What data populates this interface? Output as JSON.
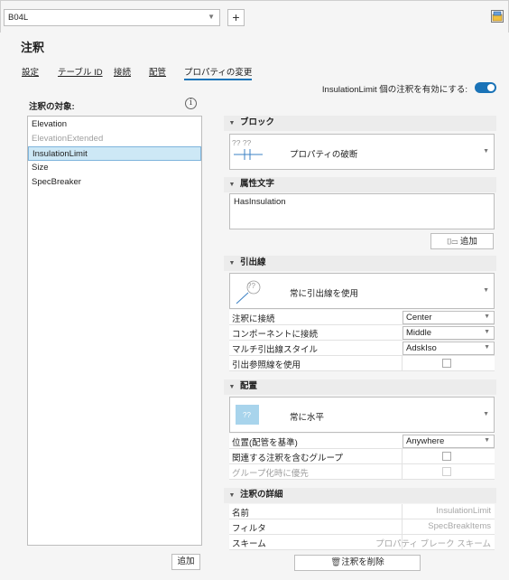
{
  "topbar": {
    "combo_value": "B04L",
    "add_symbol": "+"
  },
  "header": {
    "title": "注釈"
  },
  "tabs": [
    {
      "label": "設定"
    },
    {
      "label": "テーブル ID"
    },
    {
      "label": "接続"
    },
    {
      "label": "配管"
    },
    {
      "label": "プロパティの変更"
    }
  ],
  "toggle": {
    "label": "InsulationLimit 個の注釈を有効にする:",
    "on": true
  },
  "left": {
    "label": "注釈の対象:",
    "items": [
      "Elevation",
      "ElevationExtended",
      "InsulationLimit",
      "Size",
      "SpecBreaker"
    ],
    "add_label": "追加"
  },
  "block": {
    "title": "ブロック",
    "preview_text": "プロパティの破断",
    "thumb_text": "?? ??"
  },
  "attr": {
    "title": "属性文字",
    "value": "HasInsulation",
    "add_label": "追加"
  },
  "leader": {
    "title": "引出線",
    "preview_text": "常に引出線を使用",
    "thumb_text": "??",
    "rows": [
      {
        "label": "注釈に接続",
        "value": "Center"
      },
      {
        "label": "コンポーネントに接続",
        "value": "Middle"
      },
      {
        "label": "マルチ引出線スタイル",
        "value": "AdskIso"
      },
      {
        "label": "引出参照線を使用"
      }
    ]
  },
  "placement": {
    "title": "配置",
    "preview_text": "常に水平",
    "thumb_text": "??",
    "rows": [
      {
        "label": "位置(配管を基準)",
        "value": "Anywhere"
      },
      {
        "label": "関連する注釈を含むグループ"
      },
      {
        "label": "グループ化時に優先"
      }
    ]
  },
  "details": {
    "title": "注釈の詳細",
    "rows": [
      {
        "label": "名前",
        "value": "InsulationLimit"
      },
      {
        "label": "フィルタ",
        "value": "SpecBreakItems"
      },
      {
        "label": "スキーム",
        "value": "プロパティ ブレーク スキーム"
      }
    ]
  },
  "delete_label": "注釈を削除",
  "colors": {
    "accent": "#1a73b7",
    "selected_bg": "#cde8f6"
  }
}
